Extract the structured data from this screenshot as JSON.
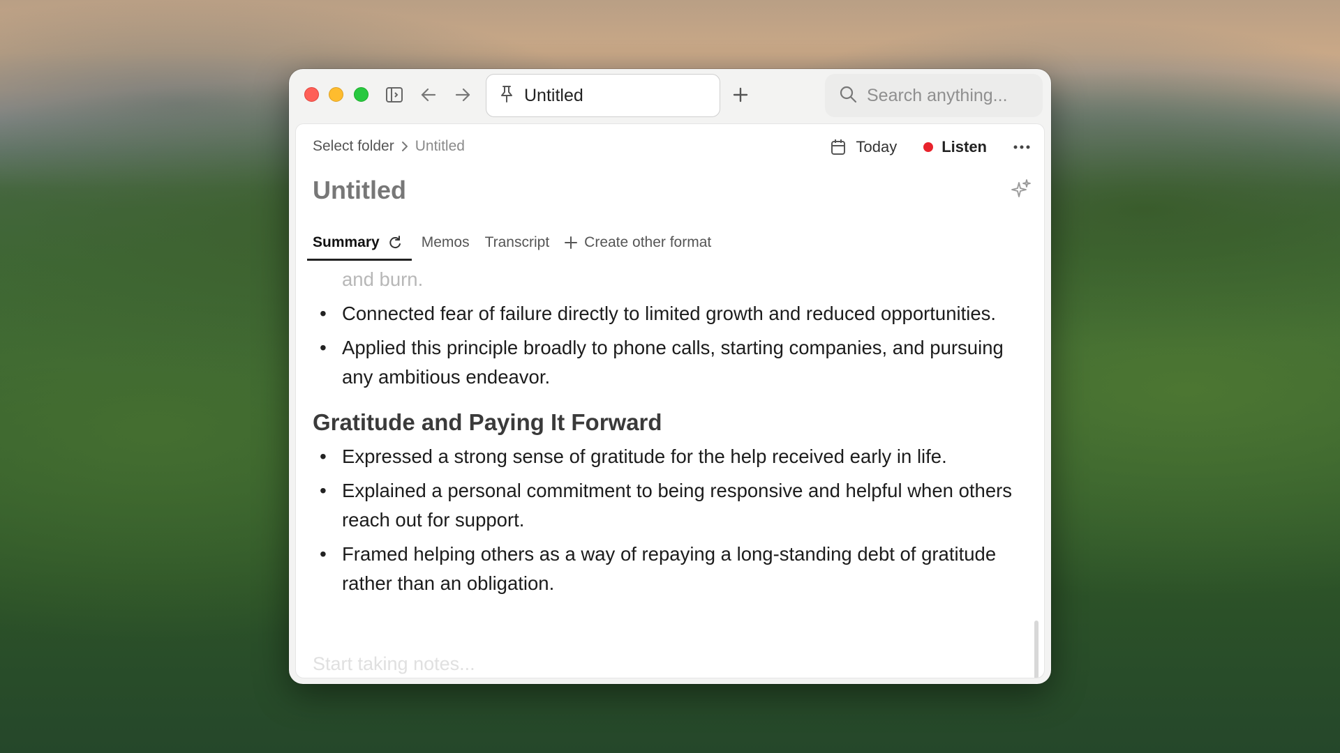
{
  "window": {
    "tab_title": "Untitled",
    "search_placeholder": "Search anything..."
  },
  "icons": {
    "sidebar_toggle": "sidebar-toggle-icon",
    "back": "arrow-left-icon",
    "forward": "arrow-right-icon",
    "pin": "pin-icon",
    "new_tab": "plus-icon",
    "search": "search-icon",
    "calendar": "calendar-icon",
    "more": "more-icon",
    "sparkle": "sparkle-icon",
    "regenerate": "refresh-icon"
  },
  "breadcrumb": {
    "folder": "Select folder",
    "current": "Untitled"
  },
  "header": {
    "today_label": "Today",
    "listen_label": "Listen"
  },
  "colors": {
    "listen_dot": "#e8232c",
    "traffic_red": "#fe5f57",
    "traffic_yellow": "#febc2e",
    "traffic_green": "#28c840"
  },
  "note": {
    "title": "Untitled",
    "tabs": {
      "summary": "Summary",
      "memos": "Memos",
      "transcript": "Transcript",
      "create_other": "Create other format"
    },
    "faded_line": "and burn.",
    "bullets_top": [
      "Connected fear of failure directly to limited growth and reduced opportunities.",
      "Applied this principle broadly to phone calls, starting companies, and pursuing any ambitious endeavor."
    ],
    "section_heading": "Gratitude and Paying It Forward",
    "bullets_section": [
      "Expressed a strong sense of gratitude for the help received early in life.",
      "Explained a personal commitment to being responsive and helpful when others reach out for support.",
      "Framed helping others as a way of repaying a long-standing debt of gratitude rather than an obligation."
    ],
    "notes_placeholder": "Start taking notes..."
  }
}
